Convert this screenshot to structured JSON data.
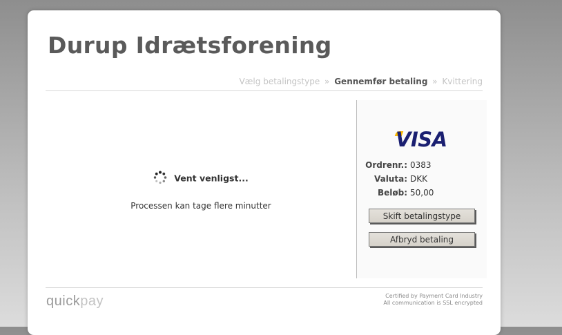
{
  "header": {
    "title": "Durup Idrætsforening"
  },
  "steps": {
    "step1": "Vælg betalingstype",
    "separator": "»",
    "step2": "Gennemfør betaling",
    "step3": "Kvittering"
  },
  "status": {
    "wait_text": "Vent venligst...",
    "process_text": "Processen kan tage flere minutter"
  },
  "payment": {
    "card_brand": "VISA",
    "order_label": "Ordrenr.:",
    "order_value": "0383",
    "currency_label": "Valuta:",
    "currency_value": "DKK",
    "amount_label": "Beløb:",
    "amount_value": "50,00"
  },
  "buttons": {
    "change_type": "Skift betalingstype",
    "cancel": "Afbryd betaling"
  },
  "footer": {
    "brand_head": "quick",
    "brand_tail": "pay",
    "certified_line1": "Certified by Payment Card Industry",
    "certified_line2": "All communication is SSL encrypted"
  },
  "colors": {
    "visa_blue": "#1a1f71",
    "visa_gold": "#f7b600",
    "title_gray": "#5a5a5a"
  }
}
